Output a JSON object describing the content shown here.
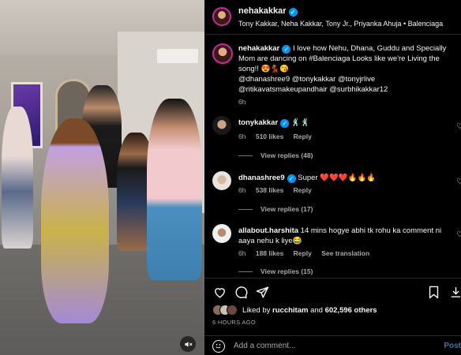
{
  "post": {
    "username": "nehakakkar",
    "tagged": "Tony Kakkar, Neha Kakkar, Tony Jr., Priyanka Ahuja • Balenciaga"
  },
  "caption": {
    "username": "nehakakkar",
    "text": "I love how Nehu, Dhana, Guddu and Specially Mom are dancing on #Balenciaga Looks like we're Living the song!! 😍💃😘",
    "mentions": "@dhanashree9 @tonykakkar @tonyjrlive @ritikavatsmakeupandhair @surbhikakkar12",
    "time": "6h"
  },
  "comments": [
    {
      "username": "tonykakkar",
      "verified": true,
      "text": "🕺🕺",
      "time": "6h",
      "likes": "510 likes",
      "reply": "Reply",
      "view_replies": "View replies (48)"
    },
    {
      "username": "dhanashree9",
      "verified": true,
      "text": "Super ❤️❤️❤️🔥🔥🔥",
      "time": "6h",
      "likes": "538 likes",
      "reply": "Reply",
      "view_replies": "View replies (17)"
    },
    {
      "username": "allabout.harshita",
      "verified": false,
      "text": "14 mins hogye abhi tk rohu ka comment ni aaya nehu k liye😂",
      "time": "6h",
      "likes": "188 likes",
      "reply": "Reply",
      "translation": "See translation",
      "view_replies": "View replies (15)"
    }
  ],
  "likes": {
    "prefix": "Liked by",
    "user": "rucchitam",
    "middle": "and",
    "count": "602,596 others"
  },
  "posted": "6 HOURS AGO",
  "add_comment": {
    "placeholder": "Add a comment...",
    "post_label": "Post"
  },
  "icons": {
    "like": "heart-icon",
    "comment": "comment-icon",
    "share": "send-icon",
    "save": "bookmark-icon",
    "mute": "speaker-muted-icon",
    "emoji": "emoji-icon"
  },
  "colors": {
    "background": "#000000",
    "verified": "#0095f6",
    "secondary_text": "#a8a8a8",
    "post_button": "#4a6fa0"
  }
}
